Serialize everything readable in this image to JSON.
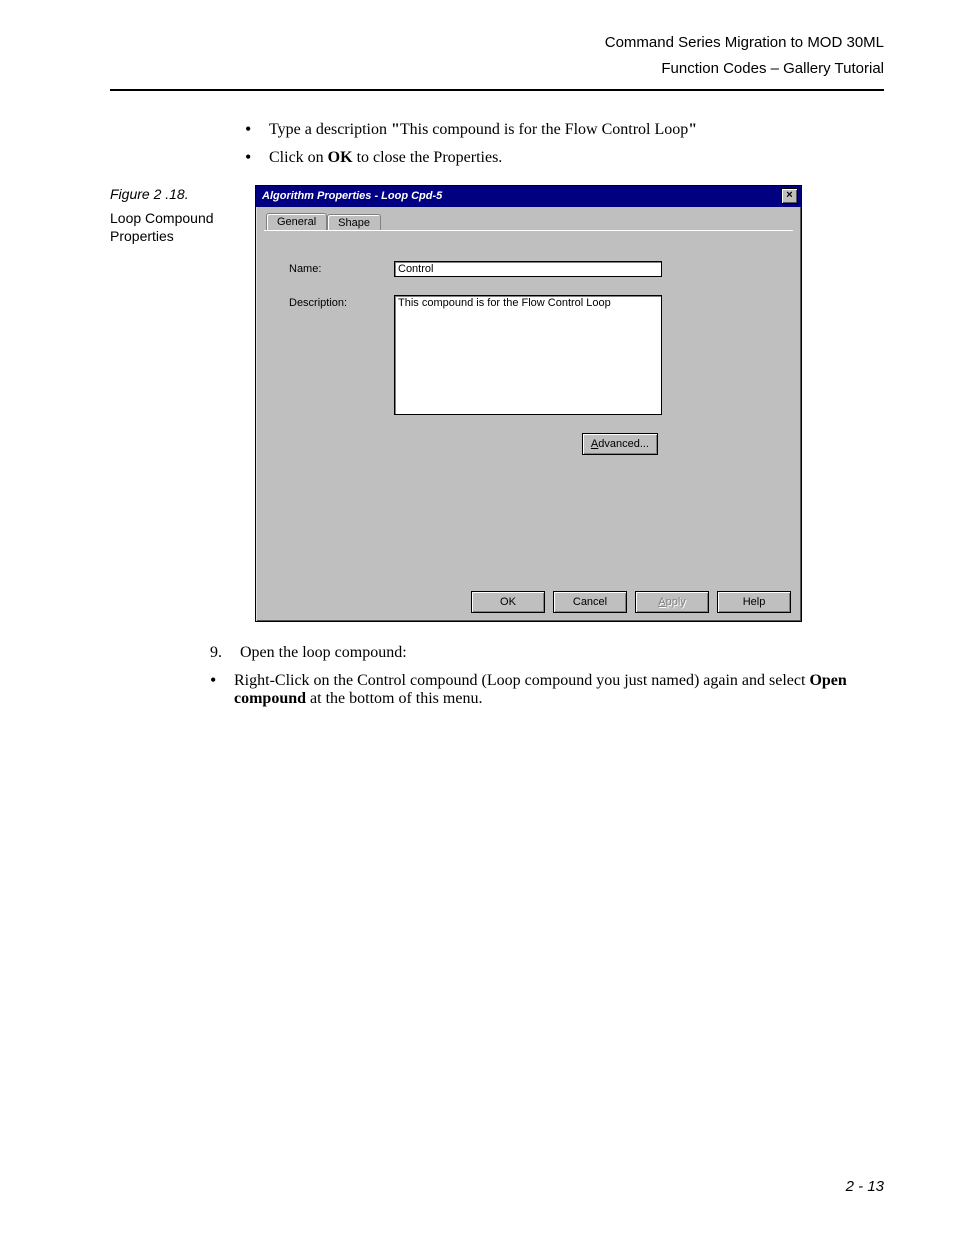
{
  "header": {
    "line1": "Command Series Migration to MOD 30ML",
    "line2": "Function Codes – Gallery Tutorial"
  },
  "instructions": {
    "b1_pre": "Type a description ",
    "b1_q1": "\"",
    "b1_txt": "This compound is for the Flow Control Loop",
    "b1_q2": "\"",
    "b2_pre": "Click on ",
    "b2_bold": "OK",
    "b2_post": " to close the Properties."
  },
  "figure": {
    "num": "Figure 2 .18.",
    "caption": "Loop Compound Properties"
  },
  "dialog": {
    "title": "Algorithm Properties - Loop Cpd-5",
    "tabs": {
      "general": "General",
      "shape": "Shape"
    },
    "labels": {
      "name": "Name:",
      "description": "Description:"
    },
    "values": {
      "name": "Control",
      "description": "This compound is for the Flow Control Loop"
    },
    "buttons": {
      "advanced": "Advanced...",
      "advanced_mn": "A",
      "ok": "OK",
      "cancel": "Cancel",
      "apply": "Apply",
      "apply_mn": "A",
      "help": "Help"
    }
  },
  "step9": {
    "num": "9.",
    "text": "Open the loop compound:",
    "bullet_pre": "Right-Click on the Control compound (Loop compound you just named) again and select ",
    "bullet_bold": "Open compound",
    "bullet_post": " at the bottom of this menu."
  },
  "footer": {
    "page": "2 - 13"
  }
}
